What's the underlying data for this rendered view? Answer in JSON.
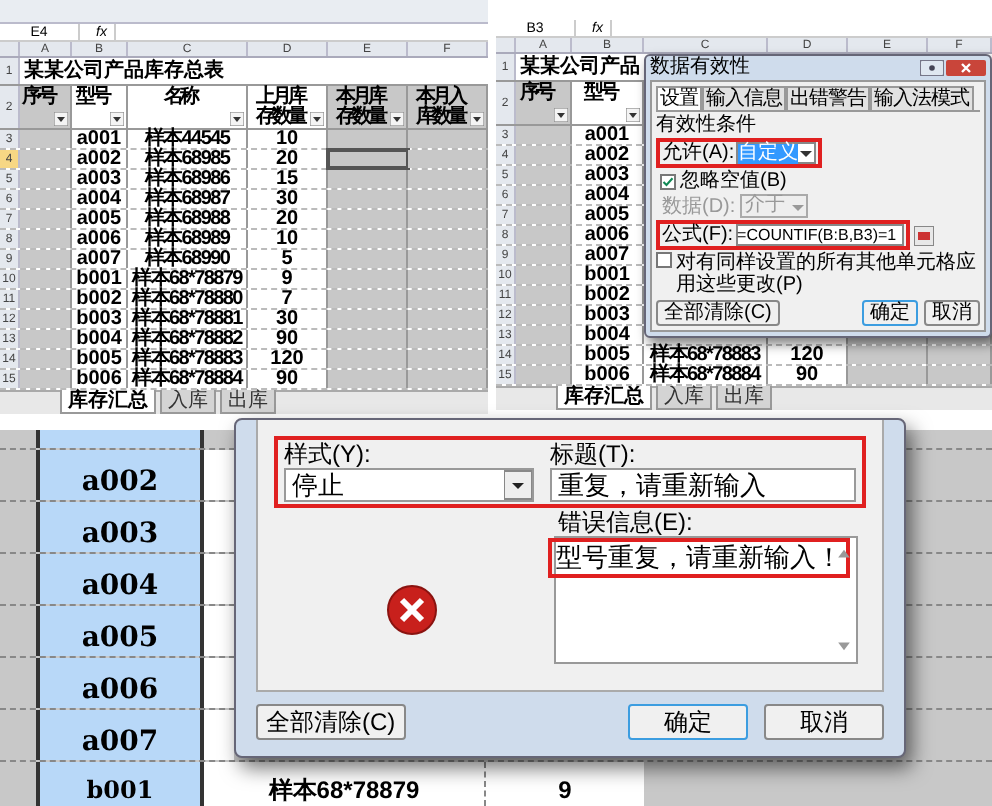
{
  "sheet1": {
    "name_box": "E4",
    "fx": "fx",
    "columns": [
      "A",
      "B",
      "C",
      "D",
      "E",
      "F"
    ],
    "title_row": "1",
    "header_row": "2",
    "title": "某某公司产品库存总表",
    "headers": [
      "序号",
      "型号",
      "名称",
      "上月库存数量",
      "本月库存数量",
      "本月入库数量"
    ],
    "rows": [
      {
        "num": "3",
        "model": "a001",
        "name": "样本44545",
        "qty": "10",
        "selected": false
      },
      {
        "num": "4",
        "model": "a002",
        "name": "样本68985",
        "qty": "20",
        "selected": true
      },
      {
        "num": "5",
        "model": "a003",
        "name": "样本68986",
        "qty": "15",
        "selected": false
      },
      {
        "num": "6",
        "model": "a004",
        "name": "样本68987",
        "qty": "30",
        "selected": false
      },
      {
        "num": "7",
        "model": "a005",
        "name": "样本68988",
        "qty": "20",
        "selected": false
      },
      {
        "num": "8",
        "model": "a006",
        "name": "样本68989",
        "qty": "10",
        "selected": false
      },
      {
        "num": "9",
        "model": "a007",
        "name": "样本68990",
        "qty": "5",
        "selected": false
      },
      {
        "num": "10",
        "model": "b001",
        "name": "样本68*78879",
        "qty": "9",
        "selected": false
      },
      {
        "num": "11",
        "model": "b002",
        "name": "样本68*78880",
        "qty": "7",
        "selected": false
      },
      {
        "num": "12",
        "model": "b003",
        "name": "样本68*78881",
        "qty": "30",
        "selected": false
      },
      {
        "num": "13",
        "model": "b004",
        "name": "样本68*78882",
        "qty": "90",
        "selected": false
      },
      {
        "num": "14",
        "model": "b005",
        "name": "样本68*78883",
        "qty": "120",
        "selected": false
      },
      {
        "num": "15",
        "model": "b006",
        "name": "样本68*78884",
        "qty": "90",
        "selected": false
      }
    ],
    "tabs": [
      {
        "label": "库存汇总",
        "selected": true
      },
      {
        "label": "入库",
        "selected": false
      },
      {
        "label": "出库",
        "selected": false
      }
    ]
  },
  "sheet2": {
    "name_box": "B3",
    "fx": "fx",
    "columns": [
      "A",
      "B",
      "C",
      "D",
      "E",
      "F"
    ],
    "title_row": "1",
    "header_row": "2",
    "title": "某某公司产品",
    "headers": [
      "序号",
      "型号"
    ],
    "rows": [
      {
        "num": "3",
        "model": "a001"
      },
      {
        "num": "4",
        "model": "a002"
      },
      {
        "num": "5",
        "model": "a003"
      },
      {
        "num": "6",
        "model": "a004"
      },
      {
        "num": "7",
        "model": "a005"
      },
      {
        "num": "8",
        "model": "a006"
      },
      {
        "num": "9",
        "model": "a007"
      },
      {
        "num": "10",
        "model": "b001"
      },
      {
        "num": "11",
        "model": "b002"
      },
      {
        "num": "12",
        "model": "b003"
      },
      {
        "num": "13",
        "model": "b004"
      },
      {
        "num": "14",
        "model": "b005",
        "name": "样本68*78883",
        "qty": "120"
      },
      {
        "num": "15",
        "model": "b006",
        "name": "样本68*78884",
        "qty": "90"
      }
    ],
    "tabs": [
      {
        "label": "库存汇总",
        "selected": true
      },
      {
        "label": "入库",
        "selected": false
      },
      {
        "label": "出库",
        "selected": false
      }
    ],
    "dialog": {
      "title": "数据有效性",
      "tabs": [
        {
          "label": "设置",
          "selected": true
        },
        {
          "label": "输入信息",
          "selected": false
        },
        {
          "label": "出错警告",
          "selected": false
        },
        {
          "label": "输入法模式",
          "selected": false
        }
      ],
      "section": "有效性条件",
      "allow_label": "允许(A):",
      "allow_value": "自定义",
      "ignore_blank": {
        "label": "忽略空值(B)",
        "checked": true
      },
      "data_label": "数据(D):",
      "data_value": "介于",
      "data_disabled": true,
      "formula_label": "公式(F):",
      "formula_value": "=COUNTIF(B:B,B3)=1",
      "apply_all": {
        "label": "对有同样设置的所有其他单元格应用这些更改(P)",
        "checked": false
      },
      "buttons": [
        {
          "label": "全部清除(C)",
          "kind": "plain"
        },
        {
          "label": "确定",
          "kind": "default"
        },
        {
          "label": "取消",
          "kind": "plain"
        }
      ]
    }
  },
  "sheet3": {
    "rows": [
      {
        "model": "a002"
      },
      {
        "model": "a003"
      },
      {
        "model": "a004"
      },
      {
        "model": "a005"
      },
      {
        "model": "a006"
      },
      {
        "model": "a007"
      }
    ],
    "last_row": {
      "model": "b001",
      "name": "样本68*78879",
      "qty": "9"
    },
    "dialog": {
      "style_label": "样式(Y):",
      "style_value": "停止",
      "title_label": "标题(T):",
      "title_value": "重复，请重新输入",
      "message_label": "错误信息(E):",
      "message": "型号重复，请重新输入！",
      "buttons": [
        {
          "label": "全部清除(C)",
          "kind": "plain"
        },
        {
          "label": "确定",
          "kind": "default"
        },
        {
          "label": "取消",
          "kind": "plain"
        }
      ]
    }
  }
}
